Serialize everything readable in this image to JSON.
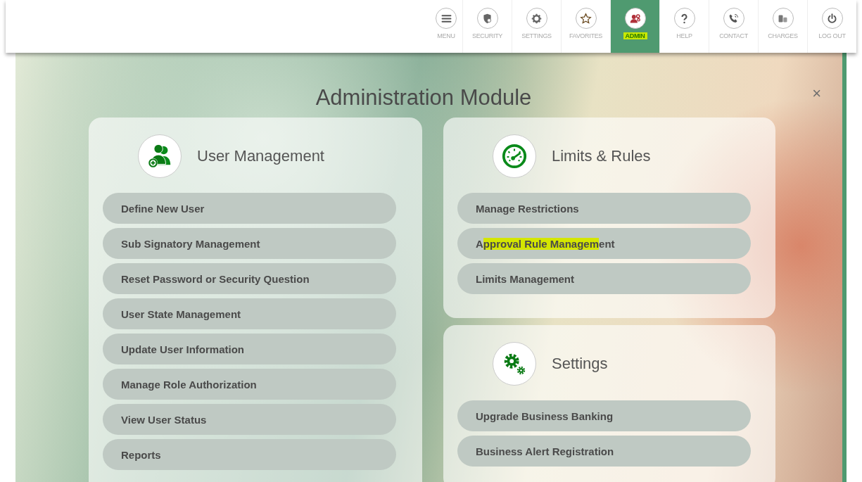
{
  "nav": [
    {
      "label": "MENU",
      "selected": false,
      "highlighted": false
    },
    {
      "label": "SECURITY",
      "selected": false,
      "highlighted": false
    },
    {
      "label": "SETTINGS",
      "selected": false,
      "highlighted": false
    },
    {
      "label": "FAVORITES",
      "selected": false,
      "highlighted": false
    },
    {
      "label": "ADMIN",
      "selected": true,
      "highlighted": true
    },
    {
      "label": "HELP",
      "selected": false,
      "highlighted": false
    },
    {
      "label": "CONTACT",
      "selected": false,
      "highlighted": false
    },
    {
      "label": "CHARGES",
      "selected": false,
      "highlighted": false
    },
    {
      "label": "LOG OUT",
      "selected": false,
      "highlighted": false
    }
  ],
  "title": "Administration Module",
  "close": "×",
  "sections": [
    {
      "title": "User Management",
      "items": [
        {
          "parts": [
            {
              "text": "Define New User",
              "highlighted": false
            }
          ]
        },
        {
          "parts": [
            {
              "text": "Sub Signatory Management",
              "highlighted": false
            }
          ]
        },
        {
          "parts": [
            {
              "text": "Reset Password or Security Question",
              "highlighted": false
            }
          ]
        },
        {
          "parts": [
            {
              "text": "User State Management",
              "highlighted": false
            }
          ]
        },
        {
          "parts": [
            {
              "text": "Update User Information",
              "highlighted": false
            }
          ]
        },
        {
          "parts": [
            {
              "text": "Manage Role Authorization",
              "highlighted": false
            }
          ]
        },
        {
          "parts": [
            {
              "text": "View User Status",
              "highlighted": false
            }
          ]
        },
        {
          "parts": [
            {
              "text": "Reports",
              "highlighted": false
            }
          ]
        }
      ]
    },
    {
      "title": "Limits & Rules",
      "items": [
        {
          "parts": [
            {
              "text": "Manage Restrictions",
              "highlighted": false
            }
          ]
        },
        {
          "parts": [
            {
              "text": "A",
              "highlighted": false
            },
            {
              "text": "pproval Rule Managem",
              "highlighted": true
            },
            {
              "text": "ent",
              "highlighted": false
            }
          ]
        },
        {
          "parts": [
            {
              "text": "Limits Management",
              "highlighted": false
            }
          ]
        }
      ]
    },
    {
      "title": "Settings",
      "items": [
        {
          "parts": [
            {
              "text": "Upgrade Business Banking",
              "highlighted": false
            }
          ]
        },
        {
          "parts": [
            {
              "text": "Business Alert Registration",
              "highlighted": false
            }
          ]
        }
      ]
    }
  ]
}
